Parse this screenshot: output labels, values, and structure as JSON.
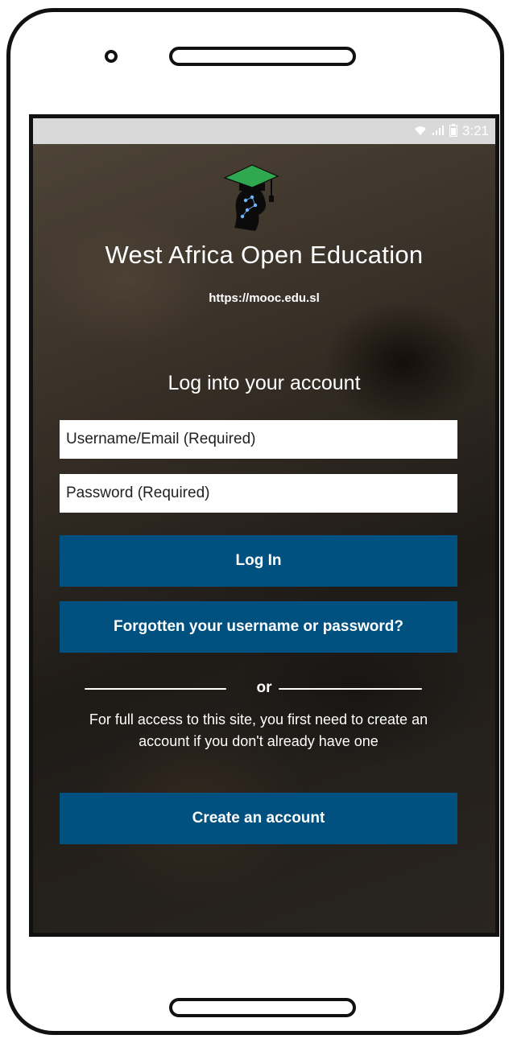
{
  "status_bar": {
    "time": "3:21",
    "icons": [
      "wifi-icon",
      "signal-icon",
      "battery-icon"
    ]
  },
  "branding": {
    "logo": "graduation-cap-head-logo",
    "title": "West Africa Open Education",
    "url": "https://mooc.edu.sl"
  },
  "login": {
    "heading": "Log into your account",
    "username_placeholder": "Username/Email (Required)",
    "password_placeholder": "Password (Required)",
    "login_button": "Log In",
    "forgot_button": "Forgotten your username or password?"
  },
  "divider": {
    "text": "or"
  },
  "signup": {
    "info": "For full access to this site, you first need to create an account if you don't already have one",
    "create_button": "Create an account"
  },
  "colors": {
    "button_bg": "#005180",
    "button_text": "#ffffff",
    "status_bar_bg": "#d9d9d9",
    "logo_cap": "#2fa84f"
  }
}
